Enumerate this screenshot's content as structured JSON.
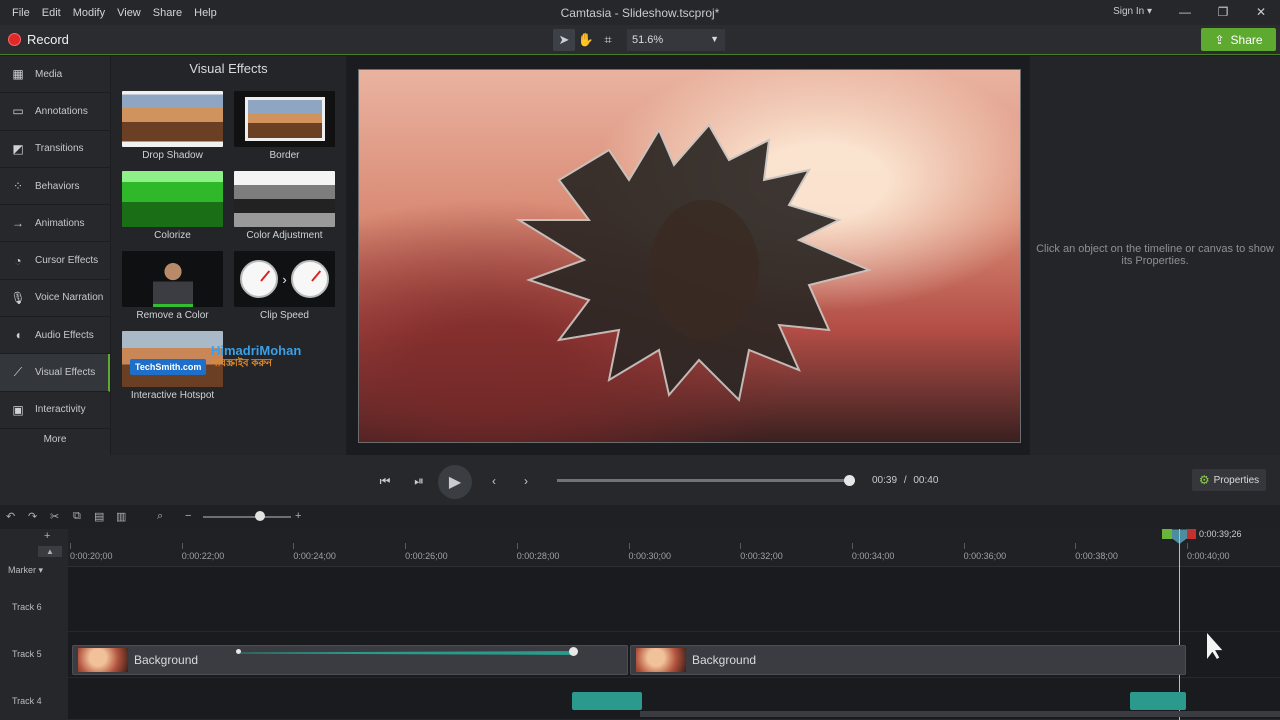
{
  "titlebar": {
    "menu": [
      "File",
      "Edit",
      "Modify",
      "View",
      "Share",
      "Help"
    ],
    "title": "Camtasia - Slideshow.tscproj*",
    "signin": "Sign In ▾"
  },
  "toolbar": {
    "record_label": "Record",
    "zoom_value": "51.6%",
    "share_label": "Share"
  },
  "leftnav": {
    "items": [
      {
        "label": "Media",
        "icon": "film-icon"
      },
      {
        "label": "Annotations",
        "icon": "annotation-icon"
      },
      {
        "label": "Transitions",
        "icon": "transition-icon"
      },
      {
        "label": "Behaviors",
        "icon": "behavior-icon"
      },
      {
        "label": "Animations",
        "icon": "animation-icon"
      },
      {
        "label": "Cursor Effects",
        "icon": "cursor-icon"
      },
      {
        "label": "Voice Narration",
        "icon": "microphone-icon"
      },
      {
        "label": "Audio Effects",
        "icon": "speaker-icon"
      },
      {
        "label": "Visual Effects",
        "icon": "wand-icon"
      },
      {
        "label": "Interactivity",
        "icon": "interactivity-icon"
      }
    ],
    "more_label": "More"
  },
  "effects": {
    "title": "Visual Effects",
    "tiles": [
      {
        "label": "Drop Shadow"
      },
      {
        "label": "Border"
      },
      {
        "label": "Colorize"
      },
      {
        "label": "Color Adjustment"
      },
      {
        "label": "Remove a Color"
      },
      {
        "label": "Clip Speed"
      },
      {
        "label": "Interactive Hotspot"
      }
    ],
    "hotspot_button_text": "TechSmith.com",
    "watermark": "HimadriMohan",
    "watermark_sub": "সাবস্ক্রাইব করুন"
  },
  "properties": {
    "hint": "Click an object on the timeline or canvas to show its Properties.",
    "button_label": "Properties"
  },
  "playback": {
    "current_time": "00:39",
    "separator": "/",
    "total_time": "00:40",
    "scrub_fraction": 0.975
  },
  "timeline": {
    "marker_label": "Marker",
    "playhead_time": "0:00:39;26",
    "ticks": [
      "0:00:20;00",
      "0:00:22;00",
      "0:00:24;00",
      "0:00:26;00",
      "0:00:28;00",
      "0:00:30;00",
      "0:00:32;00",
      "0:00:34;00",
      "0:00:36;00",
      "0:00:38;00",
      "0:00:40;00"
    ],
    "tracks": [
      {
        "label": "Track 6"
      },
      {
        "label": "Track 5"
      },
      {
        "label": "Track 4"
      }
    ],
    "clips": [
      {
        "label": "Background"
      },
      {
        "label": "Background"
      }
    ]
  },
  "colors": {
    "accent": "#5ea92f",
    "record": "#e02a2a",
    "animation": "#2a9a8a"
  }
}
